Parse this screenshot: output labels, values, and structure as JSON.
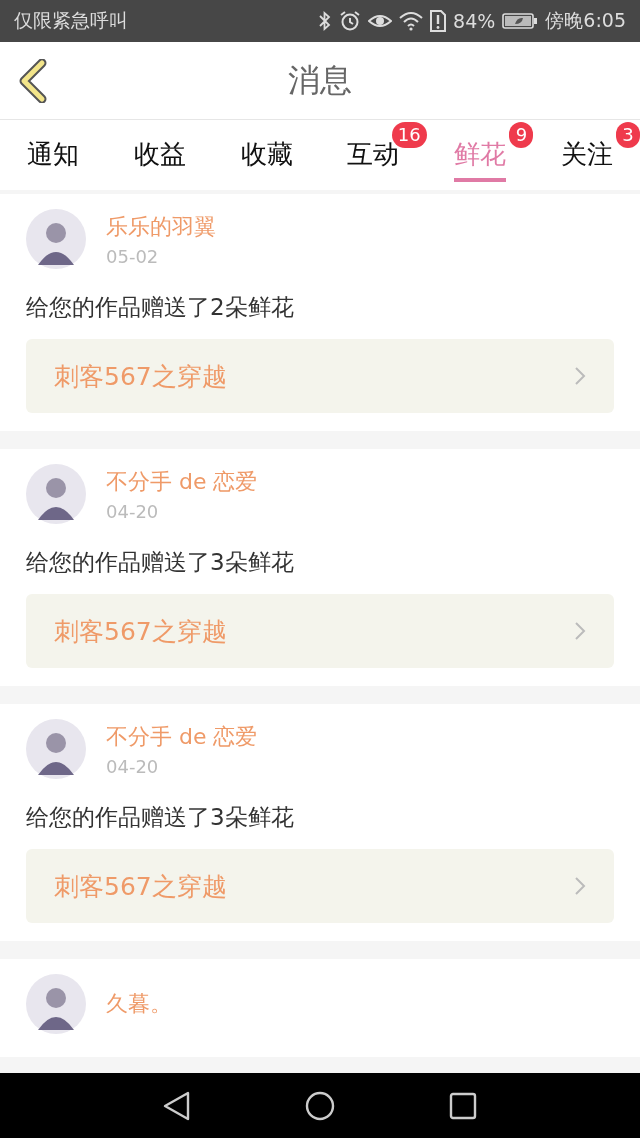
{
  "status_bar": {
    "carrier": "仅限紧急呼叫",
    "battery": "84%",
    "time": "傍晚6:05"
  },
  "header": {
    "title": "消息"
  },
  "tabs": [
    {
      "label": "通知",
      "selected": false
    },
    {
      "label": "收益",
      "selected": false
    },
    {
      "label": "收藏",
      "selected": false
    },
    {
      "label": "互动",
      "selected": false,
      "badge": "16"
    },
    {
      "label": "鲜花",
      "selected": true,
      "badge": "9"
    },
    {
      "label": "关注",
      "selected": false,
      "badge": "3"
    }
  ],
  "messages": [
    {
      "user": "乐乐的羽翼",
      "date": "05-02",
      "text": "给您的作品赠送了2朵鲜花",
      "work": "刺客567之穿越"
    },
    {
      "user": "不分手 de 恋爱",
      "date": "04-20",
      "text": "给您的作品赠送了3朵鲜花",
      "work": "刺客567之穿越"
    },
    {
      "user": "不分手 de 恋爱",
      "date": "04-20",
      "text": "给您的作品赠送了3朵鲜花",
      "work": "刺客567之穿越"
    },
    {
      "user": "久暮。"
    }
  ]
}
